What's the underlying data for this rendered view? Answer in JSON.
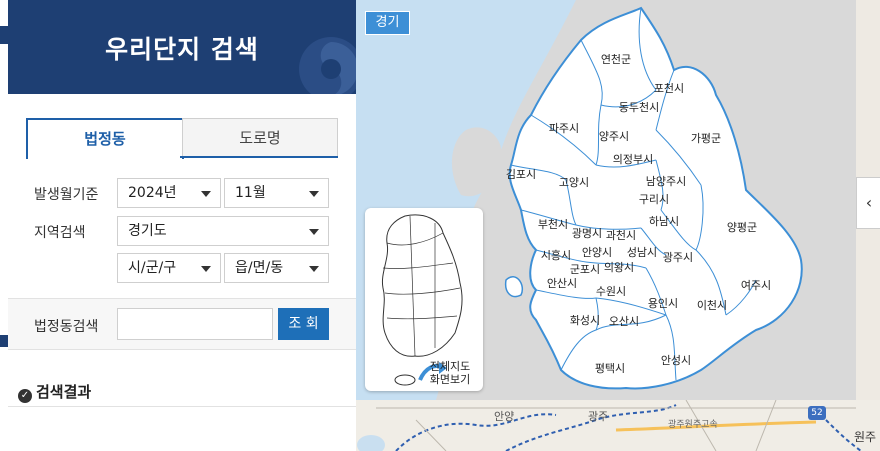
{
  "panel": {
    "title": "우리단지 검색",
    "tabs": [
      {
        "label": "법정동",
        "active": true
      },
      {
        "label": "도로명",
        "active": false
      }
    ],
    "fields": {
      "period_label": "발생월기준",
      "year": "2024년",
      "month": "11월",
      "region_label": "지역검색",
      "province": "경기도",
      "city": "시/군/구",
      "town": "읍/면/동",
      "dong_label": "법정동검색",
      "dong_value": "",
      "query_button": "조 회"
    },
    "results_title": "검색결과"
  },
  "map": {
    "region_badge": "경기",
    "districts": [
      "연천군",
      "포천시",
      "동두천시",
      "파주시",
      "양주시",
      "가평군",
      "의정부시",
      "남양주시",
      "김포시",
      "고양시",
      "구리시",
      "하남시",
      "부천시",
      "광명시",
      "과천시",
      "양평군",
      "시흥시",
      "안양시",
      "성남시",
      "광주시",
      "군포시",
      "의왕시",
      "안산시",
      "수원시",
      "여주시",
      "용인시",
      "이천시",
      "화성시",
      "오산시",
      "평택시",
      "안성시"
    ],
    "mini_map_button": "전체지도\n화면보기",
    "basemap_labels": [
      "안양",
      "광주",
      "광주원주고속",
      "원주",
      "52"
    ],
    "colors": {
      "district_fill": "#ffffff",
      "district_border": "#3d8fd6",
      "overlay": "#d9d9d9",
      "sea": "#c6dff2",
      "badge": "#3d8fd6",
      "header": "#1e3f73"
    }
  }
}
